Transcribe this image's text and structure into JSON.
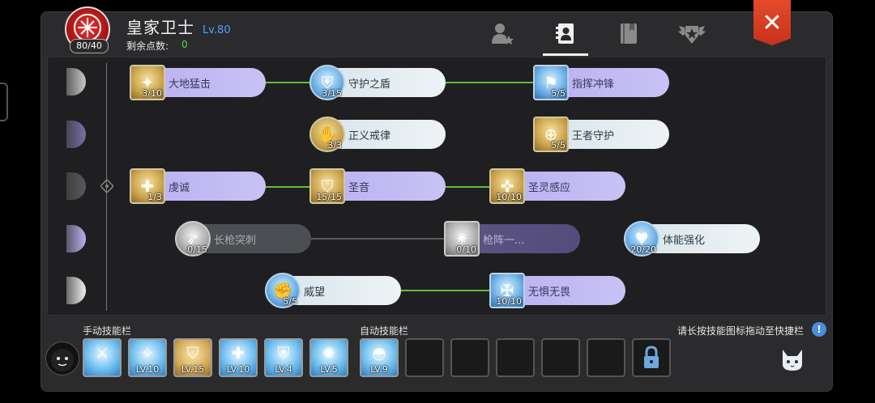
{
  "header": {
    "class_name": "皇家卫士",
    "level": "Lv.80",
    "points_label": "剩余点数:",
    "points_value": "0",
    "emblem_count": "80/40"
  },
  "tabs": [
    {
      "icon": "profile-star-icon",
      "active": false
    },
    {
      "icon": "skill-book-icon",
      "active": true
    },
    {
      "icon": "notebook-icon",
      "active": false
    },
    {
      "icon": "winged-star-emblem-icon",
      "active": false
    }
  ],
  "close": {
    "label": "✕"
  },
  "skills": [
    {
      "name": "大地猛击",
      "level": "3/10",
      "style": "gold",
      "pill": "purple"
    },
    {
      "name": "守护之盾",
      "level": "3/15",
      "style": "blue",
      "pill": "white"
    },
    {
      "name": "指挥冲锋",
      "level": "5/5",
      "style": "blue",
      "pill": "purple"
    },
    {
      "name": "正义戒律",
      "level": "3/3",
      "style": "gold",
      "pill": "white"
    },
    {
      "name": "王者守护",
      "level": "5/5",
      "style": "gold",
      "pill": "white"
    },
    {
      "name": "虔诚",
      "level": "1/3",
      "style": "gold",
      "pill": "purple"
    },
    {
      "name": "圣音",
      "level": "15/15",
      "style": "gold",
      "pill": "purple"
    },
    {
      "name": "圣灵感应",
      "level": "10/10",
      "style": "gold",
      "pill": "purple"
    },
    {
      "name": "长枪突刺",
      "level": "0/15",
      "style": "grey",
      "pill": "grey"
    },
    {
      "name": "枪阵一...",
      "level": "0/10",
      "style": "grey",
      "pill": "dim"
    },
    {
      "name": "体能强化",
      "level": "20/20",
      "style": "blue",
      "pill": "white"
    },
    {
      "name": "威望",
      "level": "5/5",
      "style": "blue",
      "pill": "white"
    },
    {
      "name": "无惧无畏",
      "level": "10/10",
      "style": "blue",
      "pill": "purple"
    }
  ],
  "bottom": {
    "manual_label": "手动技能栏",
    "auto_label": "自动技能栏",
    "hint": "请长按技能图标拖动至快捷栏",
    "manual_slots": [
      {
        "level": "",
        "style": "blue",
        "icon": "sword-burst-icon"
      },
      {
        "level": "LV.10",
        "style": "blue",
        "icon": "sparkle-orb-icon"
      },
      {
        "level": "LV.15",
        "style": "gold",
        "icon": "radiant-shield-icon"
      },
      {
        "level": "LV.10",
        "style": "blue",
        "icon": "cross-shield-icon"
      },
      {
        "level": "LV.4",
        "style": "blue",
        "icon": "winged-shield-icon"
      },
      {
        "level": "LV.5",
        "style": "blue",
        "icon": "light-burst-icon"
      }
    ],
    "auto_slots": [
      {
        "level": "LV.9",
        "style": "blue",
        "icon": "dome-shield-icon"
      },
      {
        "level": "",
        "style": "empty"
      },
      {
        "level": "",
        "style": "empty"
      },
      {
        "level": "",
        "style": "empty"
      },
      {
        "level": "",
        "style": "empty"
      },
      {
        "level": "",
        "style": "empty"
      },
      {
        "level": "",
        "style": "locked",
        "icon": "lock-icon"
      }
    ]
  },
  "colors": {
    "link_active": "#5fbf3a",
    "level_text": "#4aa3ff",
    "points": "#5fd24a",
    "close_button": "#e64a2a"
  }
}
